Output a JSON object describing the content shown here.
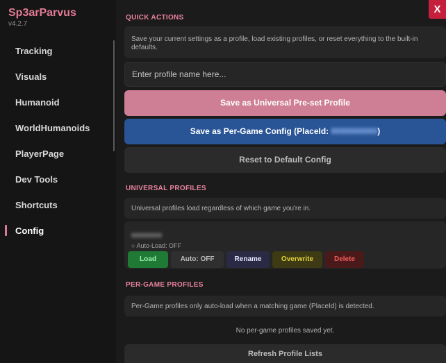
{
  "app": {
    "title": "Sp3arParvus",
    "version": "v4.2.7",
    "accent": "#e27a96"
  },
  "sidebar": {
    "items": [
      {
        "label": "Tracking"
      },
      {
        "label": "Visuals"
      },
      {
        "label": "Humanoid"
      },
      {
        "label": "WorldHumanoids"
      },
      {
        "label": "PlayerPage"
      },
      {
        "label": "Dev Tools"
      },
      {
        "label": "Shortcuts"
      },
      {
        "label": "Config",
        "active": true
      }
    ]
  },
  "quick_actions": {
    "title": "QUICK ACTIONS",
    "description": "Save your current settings as a profile, load existing profiles, or reset everything to the built-in defaults.",
    "profile_input_placeholder": "Enter profile name here...",
    "save_universal_label": "Save as Universal Pre-set Profile",
    "save_pergame_label": "Save as Per-Game Config  (PlaceId: ",
    "save_pergame_suffix": ")",
    "reset_label": "Reset to Default Config"
  },
  "universal_profiles": {
    "title": "UNIVERSAL PROFILES",
    "description": "Universal profiles load regardless of which game you're in.",
    "autoload_text": "○ Auto-Load: OFF",
    "buttons": {
      "load": "Load",
      "auto": "Auto: OFF",
      "rename": "Rename",
      "overwrite": "Overwrite",
      "delete": "Delete"
    }
  },
  "pergame_profiles": {
    "title": "PER-GAME PROFILES",
    "description": "Per-Game profiles only auto-load when a matching game (PlaceId) is detected.",
    "empty_text": "No per-game profiles saved yet."
  },
  "footer": {
    "refresh_label": "Refresh Profile Lists"
  },
  "window": {
    "close_label": "X"
  },
  "colors": {
    "pink": "#cf7f95",
    "blue": "#295596",
    "load_green": "#1f7a35",
    "rename_purple": "#2a2a44",
    "overwrite_olive": "#3d3a14",
    "delete_red": "#4a1a1a",
    "close_red": "#c5203b"
  }
}
